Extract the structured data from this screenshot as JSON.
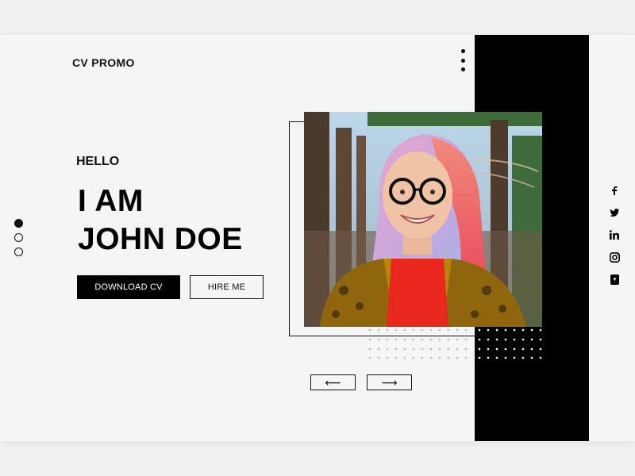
{
  "header": {
    "brand": "CV PROMO",
    "menu_icon": "vertical-dots-menu-icon"
  },
  "hero": {
    "greeting": "HELLO",
    "headline_line1": "I AM",
    "headline_line2": "JOHN DOE",
    "primary_button": "DOWNLOAD CV",
    "secondary_button": "HIRE ME"
  },
  "slider": {
    "dots": 3,
    "active_index": 0,
    "prev_icon": "arrow-left-icon",
    "next_icon": "arrow-right-icon",
    "prev_glyph": "⟵",
    "next_glyph": "⟶"
  },
  "photo": {
    "subject": "portrait-photo"
  },
  "social": {
    "icons": [
      "facebook-icon",
      "twitter-icon",
      "linkedin-icon",
      "instagram-icon",
      "youtube-icon"
    ]
  },
  "colors": {
    "background": "#f5f5f5",
    "accent": "#000000",
    "text": "#111111"
  }
}
